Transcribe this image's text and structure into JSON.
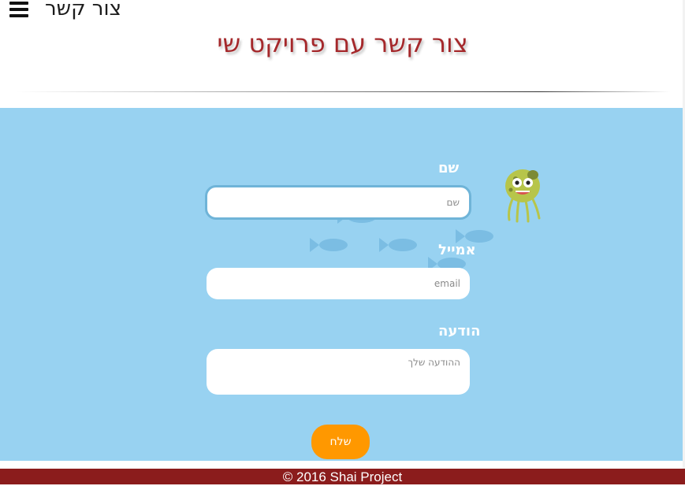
{
  "header": {
    "menu_icon": "hamburger-menu-icon",
    "page_label": "צור קשר"
  },
  "title": "צור קשר עם פרויקט שי",
  "form": {
    "name": {
      "label": "שם",
      "placeholder": "שם",
      "value": ""
    },
    "email": {
      "label": "אמייל",
      "placeholder": "email",
      "value": ""
    },
    "message": {
      "label": "הודעה",
      "placeholder": "ההודעה שלך",
      "value": ""
    },
    "submit_label": "שלח"
  },
  "decorations": {
    "mascot": "octopus-mascot-icon",
    "fish": "fish-icon"
  },
  "footer": {
    "copyright": "© 2016 Shai Project"
  },
  "colors": {
    "title": "#a5282b",
    "section_background": "#98d2f1",
    "button": "#ff9800",
    "footer": "#8b1c1c",
    "fish": "#7bbde3"
  }
}
